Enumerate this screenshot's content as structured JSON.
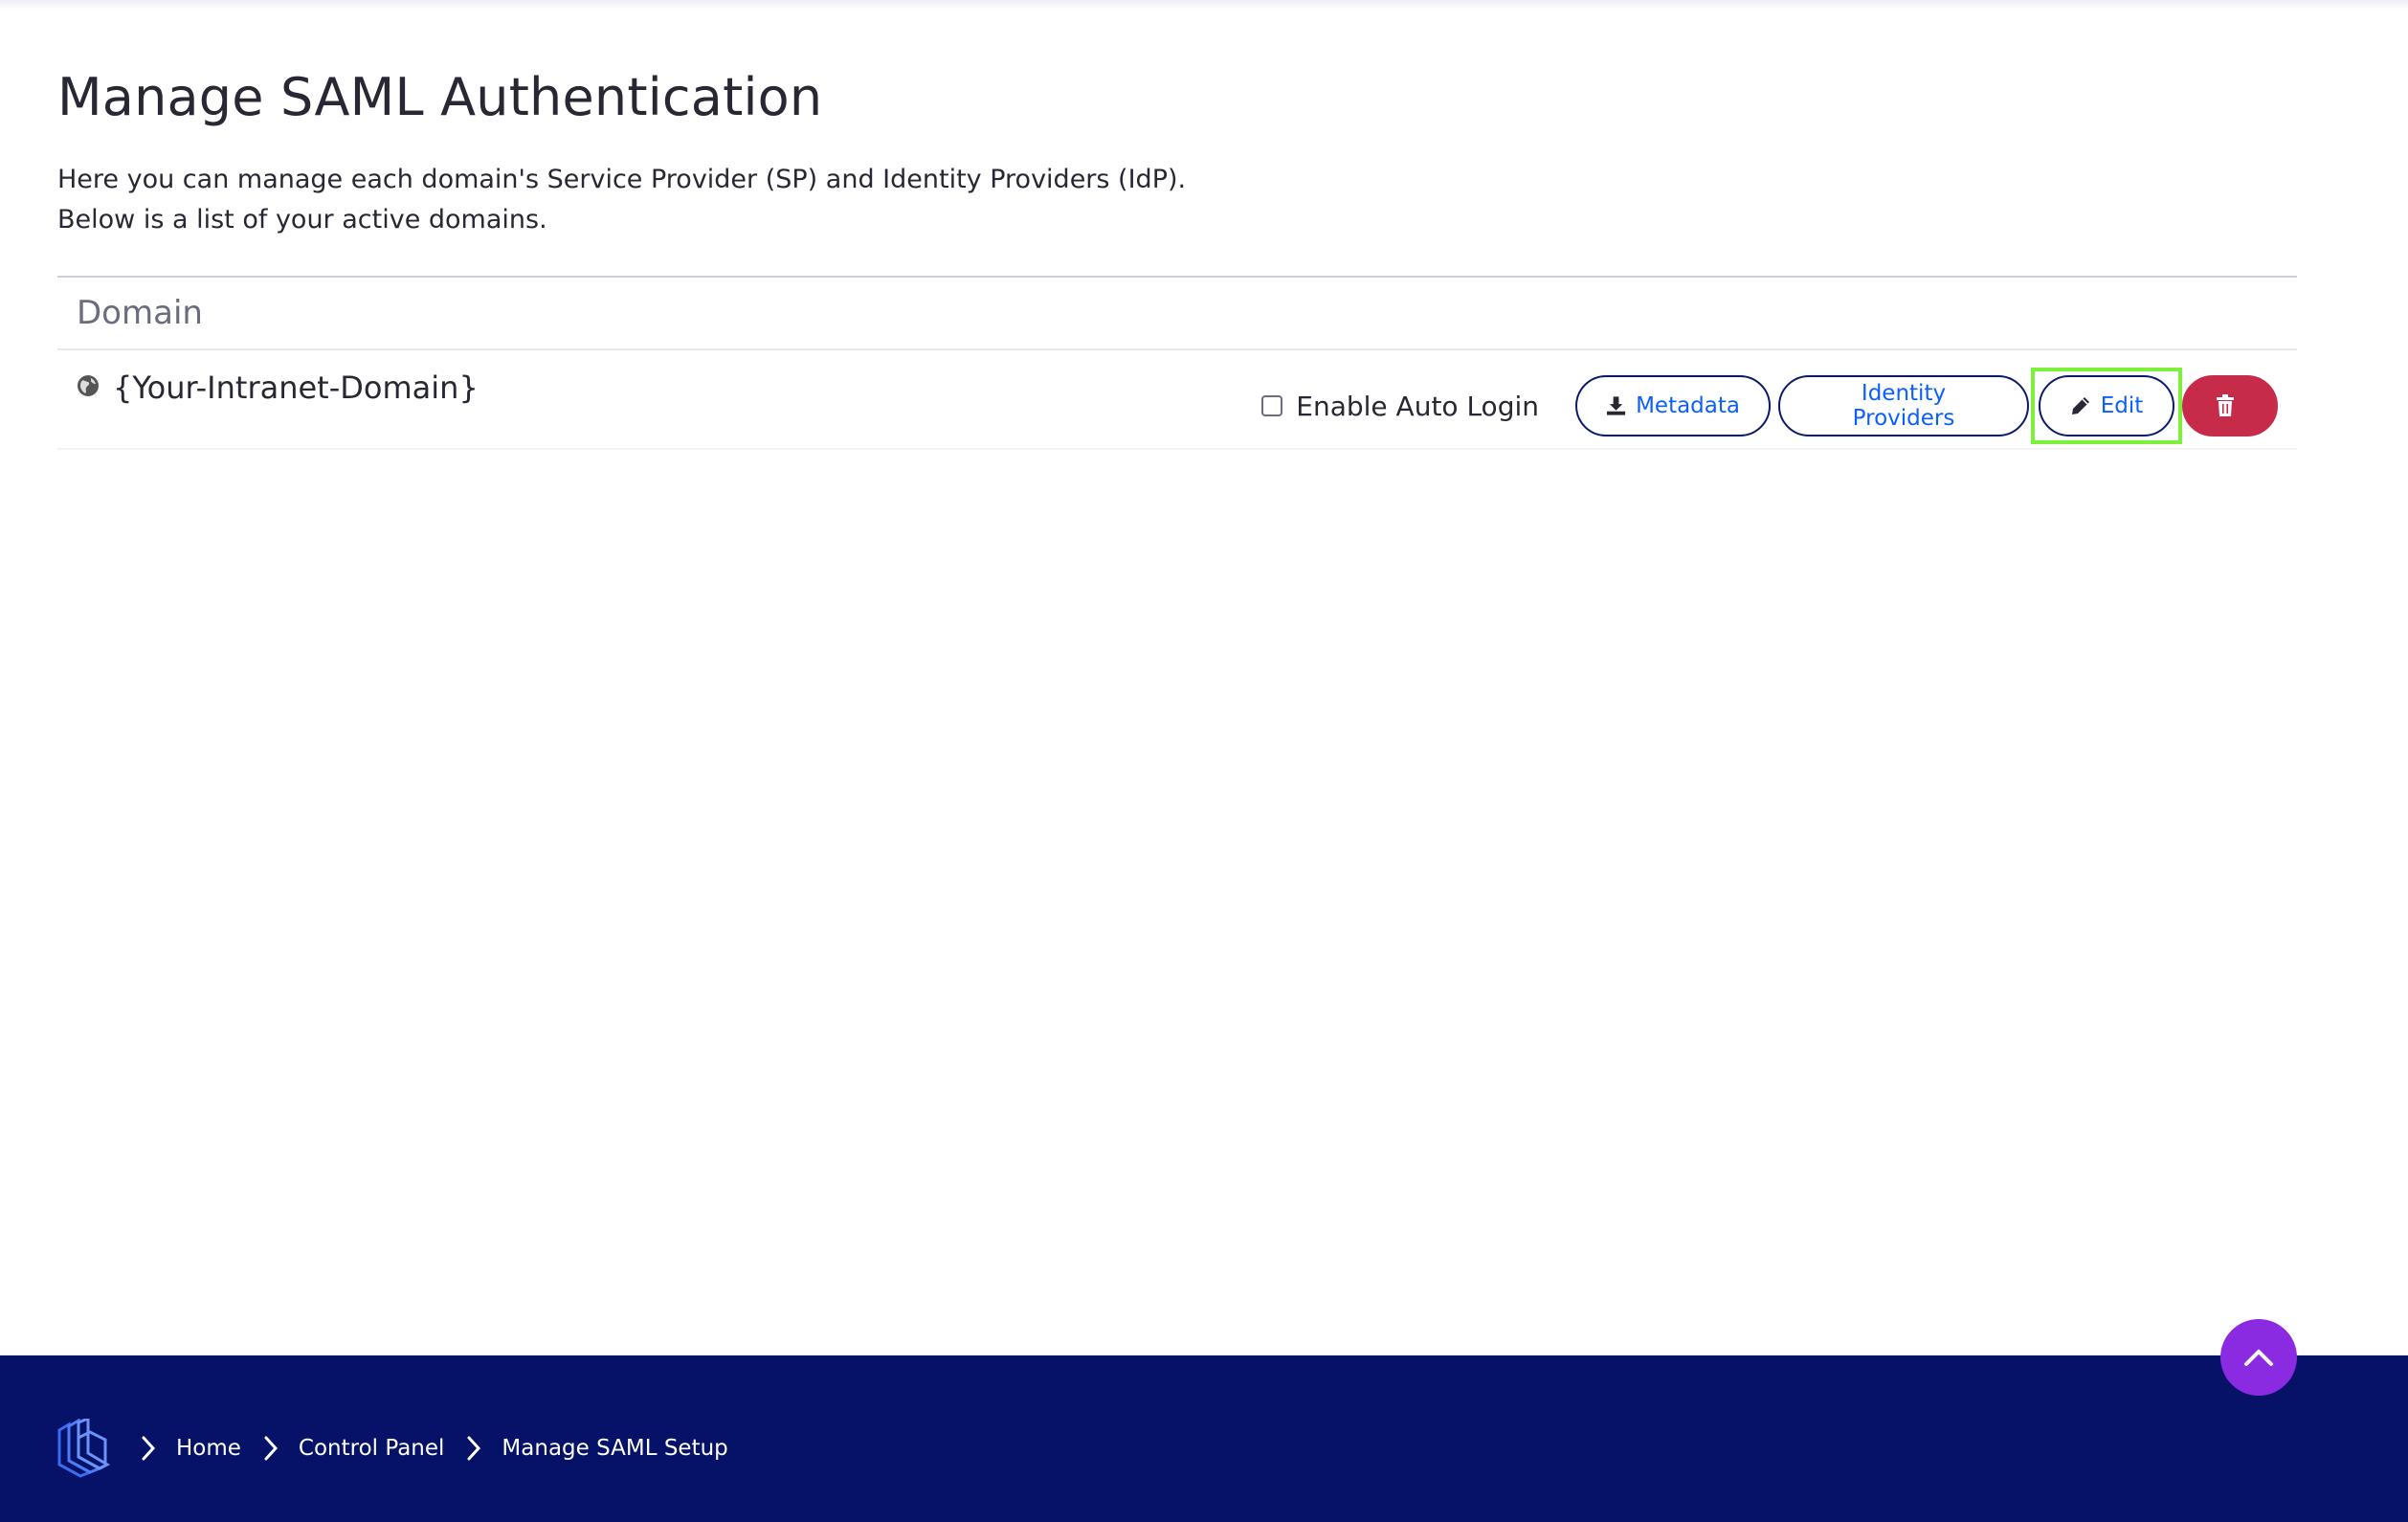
{
  "page": {
    "title": "Manage SAML Authentication",
    "description_line1": "Here you can manage each domain's Service Provider (SP) and Identity Providers (IdP).",
    "description_line2": "Below is a list of your active domains."
  },
  "table": {
    "header": "Domain",
    "rows": [
      {
        "domain": "{Your-Intranet-Domain}",
        "auto_login_label": "Enable Auto Login",
        "auto_login_checked": false,
        "metadata_label": "Metadata",
        "identity_providers_label": "Identity Providers",
        "edit_label": "Edit"
      }
    ]
  },
  "breadcrumb": {
    "items": [
      "Home",
      "Control Panel",
      "Manage SAML Setup"
    ]
  },
  "colors": {
    "primary_text": "#272833",
    "link_blue": "#0b5fff",
    "button_border": "#0b1b6b",
    "delete_red": "#c72b4a",
    "highlight_green": "#7ef03c",
    "footer_navy": "#061267",
    "scroll_top_purple": "#8a2be2"
  },
  "icons": {
    "globe": "globe-icon",
    "download": "download-icon",
    "pencil": "pencil-icon",
    "trash": "trash-icon",
    "chevron_up": "chevron-up-icon",
    "chevron_right": "chevron-right-icon",
    "logo": "liferay-logo-icon"
  }
}
